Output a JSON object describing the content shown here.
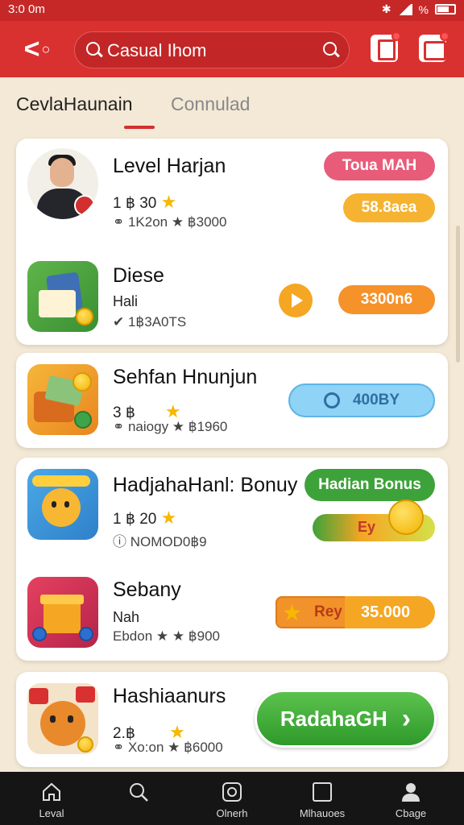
{
  "status_bar": {
    "time": "3:0 0m",
    "signal": "signal",
    "battery": "%"
  },
  "header": {
    "logo": "<",
    "search_placeholder": "Casual Ihom"
  },
  "tabs": [
    {
      "label": "CevlaHaunain"
    },
    {
      "label": "Connulad"
    }
  ],
  "items": [
    {
      "title": "Level Harjan",
      "line1": "1 ฿ 30",
      "line2": "⚭ 1K2on ★ ฿3000",
      "badge": "Toua MAH",
      "price": "58.8aea"
    },
    {
      "title": "Diese",
      "line1": "Hali",
      "line2": "✔ 1฿3A0TS",
      "price": "3300n6"
    },
    {
      "title": "Sehfan Hnunjun",
      "line1": "3 ฿",
      "line2": "⚭ naiogy ★ ฿1960",
      "price": "400BY"
    },
    {
      "title": "HadjahaHanl: Bonuy",
      "line1": "1 ฿ 20",
      "line2": "ⓘ NOMOD0฿9",
      "badge": "Hadian Bonus",
      "bar_label": "Ey"
    },
    {
      "title": "Sebany",
      "line1": "Nah",
      "line2": "Ebdon ★ ★ ฿900",
      "chip_label": "Rey",
      "price": "35.000"
    },
    {
      "title": "Hashiaanurs",
      "line1": "2.฿",
      "line2": "⚭ Xo:on ★ ฿6000",
      "cta": "RadahaGH",
      "cta_arrow": "›"
    }
  ],
  "bottom_nav": [
    {
      "label": "Leval",
      "icon": "home-icon"
    },
    {
      "label": "",
      "icon": "search-icon"
    },
    {
      "label": "Olnerh",
      "icon": "app-icon"
    },
    {
      "label": "Mlhauoes",
      "icon": "square-icon"
    },
    {
      "label": "Cbage",
      "icon": "profile-icon"
    }
  ],
  "colors": {
    "brand_red": "#d93030",
    "pink": "#e85c7a",
    "orange": "#f5a623",
    "green": "#3ea23a",
    "blue": "#7cc9f2"
  }
}
